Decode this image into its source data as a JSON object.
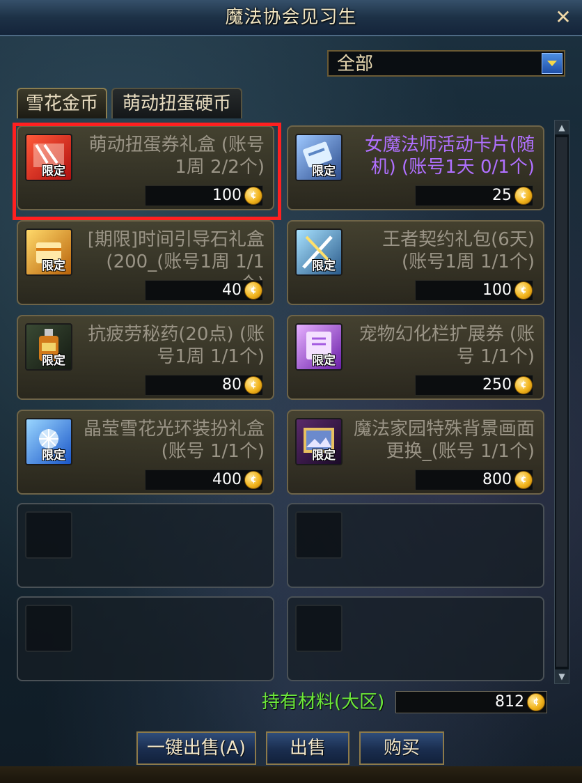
{
  "window": {
    "title": "魔法协会见习生",
    "close_symbol": "✕"
  },
  "filter": {
    "value": "全部"
  },
  "tabs": [
    {
      "label": "雪花金币",
      "active": true
    },
    {
      "label": "萌动扭蛋硬币",
      "active": false
    }
  ],
  "badge_text": "限定",
  "coin_symbol": "¢",
  "items": [
    {
      "name": "萌动扭蛋券礼盒 (账号1周 2/2个)",
      "price": "100",
      "highlighted": true,
      "name_color": "#9a9486",
      "icon": "red-gift-box-icon"
    },
    {
      "name": "女魔法师活动卡片(随机) (账号1天 0/1个)",
      "price": "25",
      "highlighted": false,
      "name_color": "#b070ff",
      "icon": "blue-card-icon"
    },
    {
      "name": "[期限]时间引导石礼盒(200_(账号1周 1/1个)",
      "price": "40",
      "highlighted": false,
      "name_color": "#9a9486",
      "icon": "gold-box-icon"
    },
    {
      "name": "王者契约礼包(6天) (账号1周 1/1个)",
      "price": "100",
      "highlighted": false,
      "name_color": "#9a9486",
      "icon": "sword-contract-icon"
    },
    {
      "name": "抗疲劳秘药(20点) (账号1周 1/1个)",
      "price": "80",
      "highlighted": false,
      "name_color": "#9a9486",
      "icon": "potion-bottle-icon"
    },
    {
      "name": "宠物幻化栏扩展券 (账号 1/1个)",
      "price": "250",
      "highlighted": false,
      "name_color": "#9a9486",
      "icon": "purple-ticket-icon"
    },
    {
      "name": "晶莹雪花光环装扮礼盒 (账号 1/1个)",
      "price": "400",
      "highlighted": false,
      "name_color": "#9a9486",
      "icon": "snow-aura-box-icon"
    },
    {
      "name": "魔法家园特殊背景画面更换_(账号 1/1个)",
      "price": "800",
      "highlighted": false,
      "name_color": "#9a9486",
      "icon": "background-frame-icon"
    }
  ],
  "holdings": {
    "label": "持有材料(大区)",
    "value": "812"
  },
  "buttons": {
    "sell_all": "一键出售(A)",
    "sell": "出售",
    "buy": "购买"
  },
  "colors": {
    "highlight": "#ff2020",
    "holdings_label": "#6dea3a",
    "accent_blue": "#2f4d7a"
  }
}
